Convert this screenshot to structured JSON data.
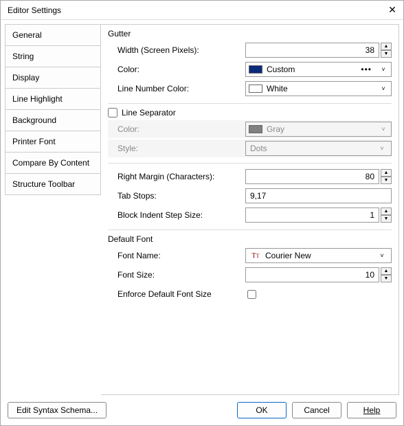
{
  "window": {
    "title": "Editor Settings"
  },
  "sidebar": {
    "items": [
      {
        "label": "General"
      },
      {
        "label": "String"
      },
      {
        "label": "Display"
      },
      {
        "label": "Line Highlight"
      },
      {
        "label": "Background"
      },
      {
        "label": "Printer Font"
      },
      {
        "label": "Compare By Content"
      },
      {
        "label": "Structure Toolbar"
      }
    ]
  },
  "gutter": {
    "label": "Gutter",
    "width_label": "Width (Screen Pixels):",
    "width_value": "38",
    "color_label": "Color:",
    "color_value": "Custom",
    "color_swatch": "#0a2a7a",
    "line_number_color_label": "Line Number Color:",
    "line_number_color_value": "White",
    "line_number_swatch": "#ffffff"
  },
  "line_separator": {
    "label": "Line Separator",
    "checked": false,
    "color_label": "Color:",
    "color_value": "Gray",
    "color_swatch": "#808080",
    "style_label": "Style:",
    "style_value": "Dots"
  },
  "margin": {
    "right_margin_label": "Right Margin (Characters):",
    "right_margin_value": "80",
    "tab_stops_label": "Tab Stops:",
    "tab_stops_value": "9,17",
    "block_indent_label": "Block Indent Step Size:",
    "block_indent_value": "1"
  },
  "font": {
    "label": "Default Font",
    "name_label": "Font Name:",
    "name_value": "Courier New",
    "size_label": "Font Size:",
    "size_value": "10",
    "enforce_label": "Enforce Default Font Size",
    "enforce_checked": false
  },
  "footer": {
    "edit_schema": "Edit Syntax Schema...",
    "ok": "OK",
    "cancel": "Cancel",
    "help": "Help"
  }
}
